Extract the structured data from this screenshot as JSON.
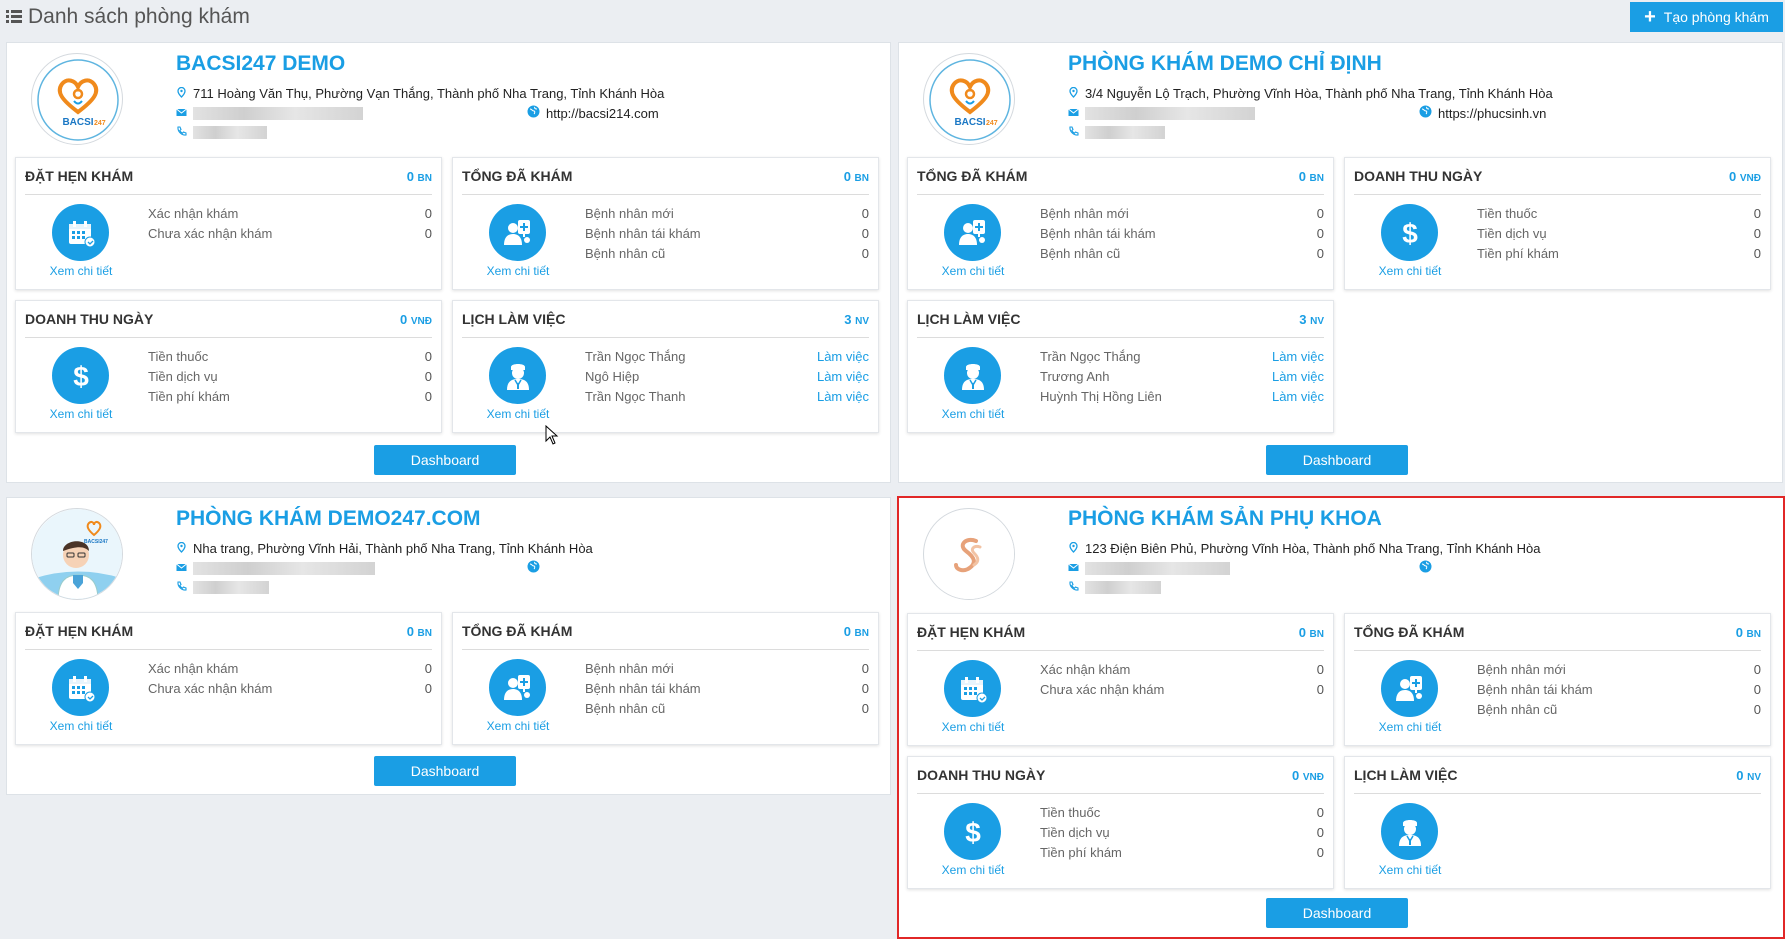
{
  "page": {
    "title": "Danh sách phòng khám",
    "create_button": "Tạo phòng khám"
  },
  "labels": {
    "view_detail": "Xem chi tiết",
    "dashboard": "Dashboard"
  },
  "colors": {
    "accent": "#1a9ee4",
    "highlight_border": "#e12727"
  },
  "clinics": [
    {
      "name": "BACSI247 DEMO",
      "address": "711 Hoàng Văn Thụ, Phường Vạn Thắng, Thành phố Nha Trang, Tỉnh Khánh Hòa",
      "website": "http://bacsi214.com",
      "logo_icon": "bacsi247-heart-logo",
      "cards": [
        {
          "title": "ĐẶT HẸN KHÁM",
          "count": "0",
          "unit": "BN",
          "icon": "calendar-icon",
          "rows": [
            {
              "label": "Xác nhận khám",
              "value": "0"
            },
            {
              "label": "Chưa xác nhận khám",
              "value": "0"
            }
          ]
        },
        {
          "title": "TỔNG ĐÃ KHÁM",
          "count": "0",
          "unit": "BN",
          "icon": "patient-icon",
          "rows": [
            {
              "label": "Bệnh nhân mới",
              "value": "0"
            },
            {
              "label": "Bệnh nhân tái khám",
              "value": "0"
            },
            {
              "label": "Bệnh nhân cũ",
              "value": "0"
            }
          ]
        },
        {
          "title": "DOANH THU NGÀY",
          "count": "0",
          "unit": "VNĐ",
          "icon": "dollar-icon",
          "rows": [
            {
              "label": "Tiền thuốc",
              "value": "0"
            },
            {
              "label": "Tiền dịch vụ",
              "value": "0"
            },
            {
              "label": "Tiền phí khám",
              "value": "0"
            }
          ]
        },
        {
          "title": "LỊCH LÀM VIỆC",
          "count": "3",
          "unit": "NV",
          "icon": "doctor-icon",
          "rows": [
            {
              "label": "Trần Ngọc Thắng",
              "value": "Làm việc"
            },
            {
              "label": "Ngô Hiệp",
              "value": "Làm việc"
            },
            {
              "label": "Trần Ngọc Thanh",
              "value": "Làm việc"
            }
          ]
        }
      ]
    },
    {
      "name": "PHÒNG KHÁM DEMO CHỈ ĐỊNH",
      "address": "3/4 Nguyễn Lộ Trạch, Phường Vĩnh Hòa, Thành phố Nha Trang, Tỉnh Khánh Hòa",
      "website": "https://phucsinh.vn",
      "logo_icon": "bacsi247-heart-logo",
      "cards": [
        {
          "title": "TỔNG ĐÃ KHÁM",
          "count": "0",
          "unit": "BN",
          "icon": "patient-icon",
          "rows": [
            {
              "label": "Bệnh nhân mới",
              "value": "0"
            },
            {
              "label": "Bệnh nhân tái khám",
              "value": "0"
            },
            {
              "label": "Bệnh nhân cũ",
              "value": "0"
            }
          ]
        },
        {
          "title": "DOANH THU NGÀY",
          "count": "0",
          "unit": "VNĐ",
          "icon": "dollar-icon",
          "rows": [
            {
              "label": "Tiền thuốc",
              "value": "0"
            },
            {
              "label": "Tiền dịch vụ",
              "value": "0"
            },
            {
              "label": "Tiền phí khám",
              "value": "0"
            }
          ]
        },
        {
          "title": "LỊCH LÀM VIỆC",
          "count": "3",
          "unit": "NV",
          "icon": "doctor-icon",
          "rows": [
            {
              "label": "Trần Ngọc Thắng",
              "value": "Làm việc"
            },
            {
              "label": "Trương Anh",
              "value": "Làm việc"
            },
            {
              "label": "Huỳnh Thị Hồng Liên",
              "value": "Làm việc"
            }
          ]
        }
      ]
    },
    {
      "name": "PHÒNG KHÁM DEMO247.COM",
      "address": "Nha trang, Phường Vĩnh Hải, Thành phố Nha Trang, Tỉnh Khánh Hòa",
      "website": "",
      "logo_icon": "doctor-avatar-logo",
      "cards": [
        {
          "title": "ĐẶT HẸN KHÁM",
          "count": "0",
          "unit": "BN",
          "icon": "calendar-icon",
          "rows": [
            {
              "label": "Xác nhận khám",
              "value": "0"
            },
            {
              "label": "Chưa xác nhận khám",
              "value": "0"
            }
          ]
        },
        {
          "title": "TỔNG ĐÃ KHÁM",
          "count": "0",
          "unit": "BN",
          "icon": "patient-icon",
          "rows": [
            {
              "label": "Bệnh nhân mới",
              "value": "0"
            },
            {
              "label": "Bệnh nhân tái khám",
              "value": "0"
            },
            {
              "label": "Bệnh nhân cũ",
              "value": "0"
            }
          ]
        }
      ]
    },
    {
      "name": "PHÒNG KHÁM SẢN PHỤ KHOA",
      "address": "123 Điện Biên Phủ, Phường Vĩnh Hòa, Thành phố Nha Trang, Tỉnh Khánh Hòa",
      "website": "",
      "logo_icon": "swan-logo",
      "cards": [
        {
          "title": "ĐẶT HẸN KHÁM",
          "count": "0",
          "unit": "BN",
          "icon": "calendar-icon",
          "rows": [
            {
              "label": "Xác nhận khám",
              "value": "0"
            },
            {
              "label": "Chưa xác nhận khám",
              "value": "0"
            }
          ]
        },
        {
          "title": "TỔNG ĐÃ KHÁM",
          "count": "0",
          "unit": "BN",
          "icon": "patient-icon",
          "rows": [
            {
              "label": "Bệnh nhân mới",
              "value": "0"
            },
            {
              "label": "Bệnh nhân tái khám",
              "value": "0"
            },
            {
              "label": "Bệnh nhân cũ",
              "value": "0"
            }
          ]
        },
        {
          "title": "DOANH THU NGÀY",
          "count": "0",
          "unit": "VNĐ",
          "icon": "dollar-icon",
          "rows": [
            {
              "label": "Tiền thuốc",
              "value": "0"
            },
            {
              "label": "Tiền dịch vụ",
              "value": "0"
            },
            {
              "label": "Tiền phí khám",
              "value": "0"
            }
          ]
        },
        {
          "title": "LỊCH LÀM VIỆC",
          "count": "0",
          "unit": "NV",
          "icon": "doctor-icon",
          "rows": []
        }
      ]
    }
  ]
}
